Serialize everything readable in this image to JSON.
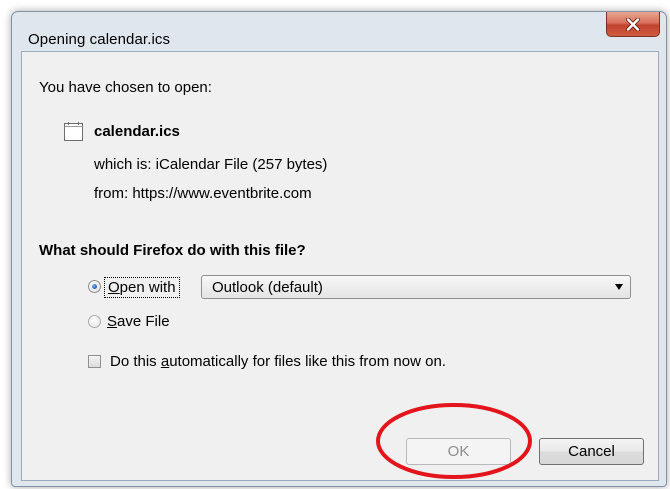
{
  "window": {
    "title": "Opening calendar.ics",
    "close_icon": "close-x-icon"
  },
  "file": {
    "intro": "You have chosen to open:",
    "name": "calendar.ics",
    "icon": "calendar-file-icon",
    "which_is": "which is: iCalendar File (257 bytes)",
    "from": "from:  https://www.eventbrite.com"
  },
  "action": {
    "question": "What should Firefox do with this file?",
    "open_with": {
      "label_accesskey": "O",
      "label_rest": "pen with",
      "selected": true,
      "app": "Outlook (default)"
    },
    "save_file": {
      "label_accesskey": "S",
      "label_rest": "ave File",
      "selected": false
    },
    "auto": {
      "label_prefix": "Do this ",
      "label_accesskey": "a",
      "label_rest": "utomatically for files like this from now on.",
      "checked": false
    }
  },
  "buttons": {
    "ok": "OK",
    "cancel": "Cancel"
  },
  "annotation": {
    "color": "#e3141b",
    "target": "ok-button"
  },
  "colors": {
    "frame": "#dfe6ee",
    "client": "#f0f0f0",
    "close_button": "#c9533b"
  }
}
